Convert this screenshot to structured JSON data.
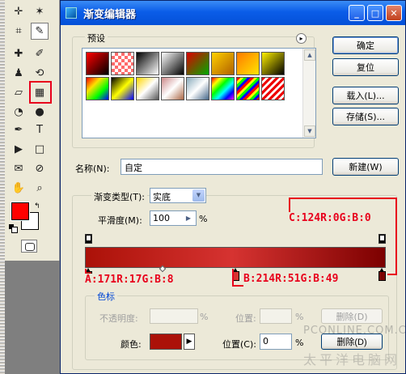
{
  "toolbox": {
    "tools": [
      {
        "name": "move-icon",
        "glyph": "✛"
      },
      {
        "name": "magic-wand-icon",
        "glyph": "✶"
      },
      {
        "name": "crop-icon",
        "glyph": "⌗"
      },
      {
        "name": "eyedropper-icon",
        "glyph": "✎"
      },
      {
        "name": "healing-brush-icon",
        "glyph": "✚"
      },
      {
        "name": "brush-icon",
        "glyph": "✐"
      },
      {
        "name": "stamp-icon",
        "glyph": "♟"
      },
      {
        "name": "history-brush-icon",
        "glyph": "⟲"
      },
      {
        "name": "eraser-icon",
        "glyph": "▱"
      },
      {
        "name": "gradient-icon",
        "glyph": "▦"
      },
      {
        "name": "blur-icon",
        "glyph": "◔"
      },
      {
        "name": "dodge-icon",
        "glyph": "●"
      },
      {
        "name": "pen-icon",
        "glyph": "✒"
      },
      {
        "name": "type-icon",
        "glyph": "T"
      },
      {
        "name": "path-select-icon",
        "glyph": "▶"
      },
      {
        "name": "shape-icon",
        "glyph": "□"
      },
      {
        "name": "notes-icon",
        "glyph": "✉"
      },
      {
        "name": "measure-icon",
        "glyph": "⊘"
      },
      {
        "name": "hand-icon",
        "glyph": "✋"
      },
      {
        "name": "zoom-icon",
        "glyph": "⌕"
      }
    ],
    "foreground_color": "#ff0000",
    "background_color": "#ffffff"
  },
  "dialog": {
    "title": "渐变编辑器",
    "min_glyph": "_",
    "max_glyph": "□",
    "close_glyph": "✕",
    "presets_label": "预设",
    "presets_menu_glyph": "▸",
    "buttons": {
      "ok": "确定",
      "reset": "复位",
      "load": "载入(L)...",
      "save": "存储(S)...",
      "new": "新建(W)"
    },
    "name_label": "名称(N):",
    "name_value": "自定",
    "gradient_type_label": "渐变类型(T):",
    "gradient_type_value": "实底",
    "smoothness_label": "平滑度(M):",
    "smoothness_value": "100",
    "percent": "%",
    "stops_label": "色标",
    "opacity_label": "不透明度:",
    "position_label_disabled": "位置:",
    "delete_label_disabled": "删除(D)",
    "color_label": "颜色:",
    "position_label": "位置(C):",
    "position_value": "0",
    "delete_label": "删除(D)",
    "stop_colors": {
      "a": "#ab1108",
      "b": "#d63331",
      "c": "#7c0000"
    }
  },
  "annotations": {
    "c": "C:124R:0G:B:0",
    "a": "A:171R:17G:B:8",
    "b": "B:214R:51G:B:49",
    "color": "#e8001c"
  },
  "watermark": {
    "line1": "PCONLINE.COM.CN",
    "line2": "太平洋电脑网"
  }
}
